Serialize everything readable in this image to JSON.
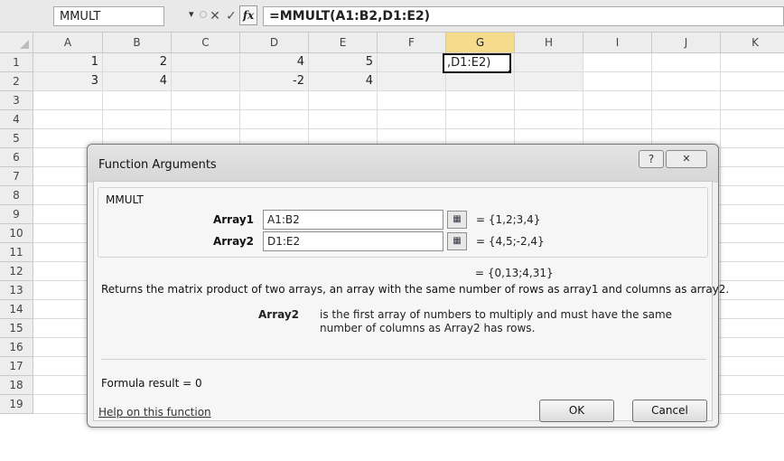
{
  "formula_bar": {
    "name_box": "MMULT",
    "dropdown_icon": "chevron-down-icon",
    "cancel_symbol": "✕",
    "enter_symbol": "✓",
    "fx_label": "fx",
    "formula": "=MMULT(A1:B2,D1:E2)"
  },
  "grid": {
    "columns": [
      "A",
      "B",
      "C",
      "D",
      "E",
      "F",
      "G",
      "H",
      "I",
      "J",
      "K"
    ],
    "rows": [
      "1",
      "2",
      "3",
      "4",
      "5",
      "6",
      "7",
      "8",
      "9",
      "10",
      "11",
      "12",
      "13",
      "14",
      "15",
      "16",
      "17",
      "18",
      "19"
    ],
    "active_column": "G",
    "cells": {
      "A1": "1",
      "B1": "2",
      "D1": "4",
      "E1": "5",
      "A2": "3",
      "B2": "4",
      "D2": "-2",
      "E2": "4"
    },
    "editing_cell_text": ",D1:E2)"
  },
  "dialog": {
    "title": "Function Arguments",
    "help_symbol": "?",
    "close_symbol": "✕",
    "function_name": "MMULT",
    "args": [
      {
        "label": "Array1",
        "input": "A1:B2",
        "value": "=  {1,2;3,4}"
      },
      {
        "label": "Array2",
        "input": "D1:E2",
        "value": "=  {4,5;-2,4}"
      }
    ],
    "result_value": "=  {0,13;4,31}",
    "description": "Returns the matrix product of two arrays, an array with the same number of rows as array1 and columns as array2.",
    "arg_desc_label": "Array2",
    "arg_desc_text": "is the first array of numbers to multiply and must have the same number of columns as Array2 has rows.",
    "formula_result": "Formula result =   0",
    "help_link": "Help on this function",
    "ok_label": "OK",
    "cancel_label": "Cancel"
  }
}
